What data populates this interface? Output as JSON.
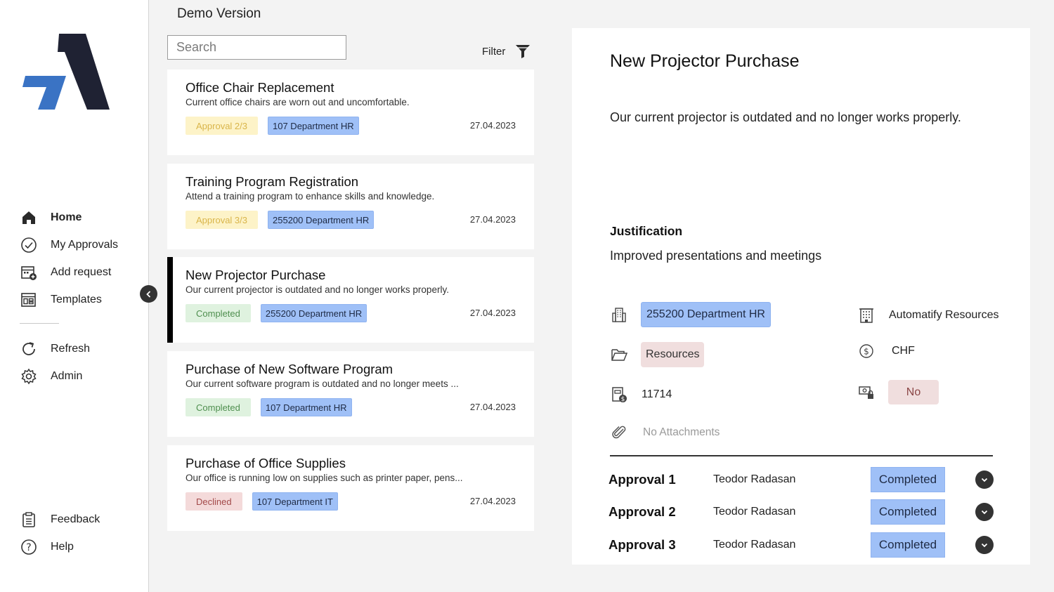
{
  "sidebar": {
    "nav": [
      {
        "label": "Home",
        "icon": "home-icon",
        "active": true
      },
      {
        "label": "My Approvals",
        "icon": "check-circle-icon"
      },
      {
        "label": "Add request",
        "icon": "calendar-add-icon"
      },
      {
        "label": "Templates",
        "icon": "template-icon"
      }
    ],
    "nav2": [
      {
        "label": "Refresh",
        "icon": "refresh-icon"
      },
      {
        "label": "Admin",
        "icon": "gear-icon"
      }
    ],
    "bottom": [
      {
        "label": "Feedback",
        "icon": "clipboard-icon"
      },
      {
        "label": "Help",
        "icon": "help-icon"
      }
    ]
  },
  "list": {
    "title": "Demo Version",
    "search_placeholder": "Search",
    "filter_label": "Filter",
    "cards": [
      {
        "title": "Office Chair Replacement",
        "desc": "Current office chairs are worn out and uncomfortable.",
        "status": "Approval 2/3",
        "status_kind": "approval",
        "dept": "107 Department HR",
        "date": "27.04.2023"
      },
      {
        "title": "Training Program Registration",
        "desc": "Attend a training program to enhance skills and knowledge.",
        "status": "Approval 3/3",
        "status_kind": "approval",
        "dept": "255200 Department HR",
        "date": "27.04.2023"
      },
      {
        "title": "New Projector Purchase",
        "desc": "Our current projector is outdated and no longer works properly.",
        "status": "Completed",
        "status_kind": "completed",
        "dept": "255200 Department HR",
        "date": "27.04.2023",
        "selected": true
      },
      {
        "title": "Purchase of New Software Program",
        "desc": "Our current software program is outdated and no longer meets ...",
        "status": "Completed",
        "status_kind": "completed",
        "dept": "107 Department HR",
        "date": "27.04.2023"
      },
      {
        "title": "Purchase of Office Supplies",
        "desc": "Our office is running low on supplies such as printer paper, pens...",
        "status": "Declined",
        "status_kind": "declined",
        "dept": "107 Department IT",
        "date": "27.04.2023"
      }
    ]
  },
  "detail": {
    "title": "New Projector Purchase",
    "description": "Our current projector is outdated and no longer works properly.",
    "justification_heading": "Justification",
    "justification": "Improved presentations and meetings",
    "department": "255200 Department HR",
    "company": "Automatify Resources",
    "category": "Resources",
    "currency": "CHF",
    "amount": "11714",
    "budget_flag": "No",
    "attachments": "No Attachments",
    "approvals": [
      {
        "name": "Approval 1",
        "person": "Teodor Radasan",
        "status": "Completed"
      },
      {
        "name": "Approval 2",
        "person": "Teodor Radasan",
        "status": "Completed"
      },
      {
        "name": "Approval 3",
        "person": "Teodor Radasan",
        "status": "Completed"
      }
    ]
  },
  "colors": {
    "brand_dark": "#1f2233",
    "brand_blue": "#3a73c4",
    "dept_tag": "#9fc0f7",
    "approval_tag": "#fdf3c8",
    "completed_tag": "#dff2df",
    "declined_tag": "#f4dada"
  }
}
